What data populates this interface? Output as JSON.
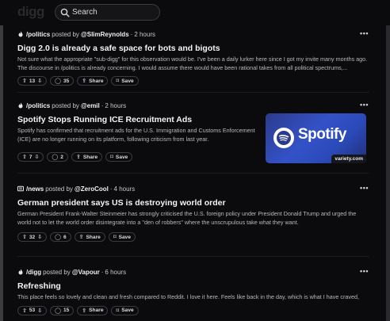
{
  "app": {
    "logo": "digg"
  },
  "search": {
    "placeholder": "Search"
  },
  "actions": {
    "share": "Share",
    "save": "Save"
  },
  "posts": [
    {
      "community": "/politics",
      "posted_by": "posted by",
      "author": "@SlimReynolds",
      "time": "2 hours",
      "title": "Digg 2.0 is already a safe space for bots and bigots",
      "excerpt": "Not sure what the appropriate \"sub-digg\" for this observation would be. I've been a daily lurker here since I got my invite many months ago. The discourse in /politics is already concerning. I would assume there would have been rational takes from all political spectrums,...",
      "upvotes": "13",
      "comments": "35"
    },
    {
      "community": "/politics",
      "posted_by": "posted by",
      "author": "@emil",
      "time": "2 hours",
      "title": "Spotify Stops Running ICE Recruitment Ads",
      "excerpt": "Spotify has confirmed that recruitment ads for the U.S. Immigration and Customs Enforcement (ICE) are no longer running on its platform, following criticism from last year.",
      "upvotes": "7",
      "comments": "2",
      "thumbnail": {
        "brand": "Spotify",
        "source": "variety.com",
        "bg": "#3452c8"
      }
    },
    {
      "community": "/news",
      "posted_by": "posted by",
      "author": "@ZeroCool",
      "time": "4 hours",
      "title": "German president says US is destroying world order",
      "excerpt": "German President Frank-Walter Steinmeier has strongly criticised the U.S. foreign policy under President Donald Trump and urged the world not to let the world order disintegrate into a \"den of robbers\" where the unscrupulous take what they want.",
      "upvotes": "32",
      "comments": "6"
    },
    {
      "community": "/digg",
      "posted_by": "posted by",
      "author": "@Vapour",
      "time": "6 hours",
      "title": "Refreshing",
      "excerpt": "This place feels so lovely and clean and fresh compared to Reddit. I love it here. Feels like back in the day, which is what I have craved,",
      "upvotes": "53",
      "comments": "15"
    }
  ],
  "colors": {
    "background": "#0b0b0d",
    "border": "#3a3a40",
    "text": "#e8e8ea"
  }
}
